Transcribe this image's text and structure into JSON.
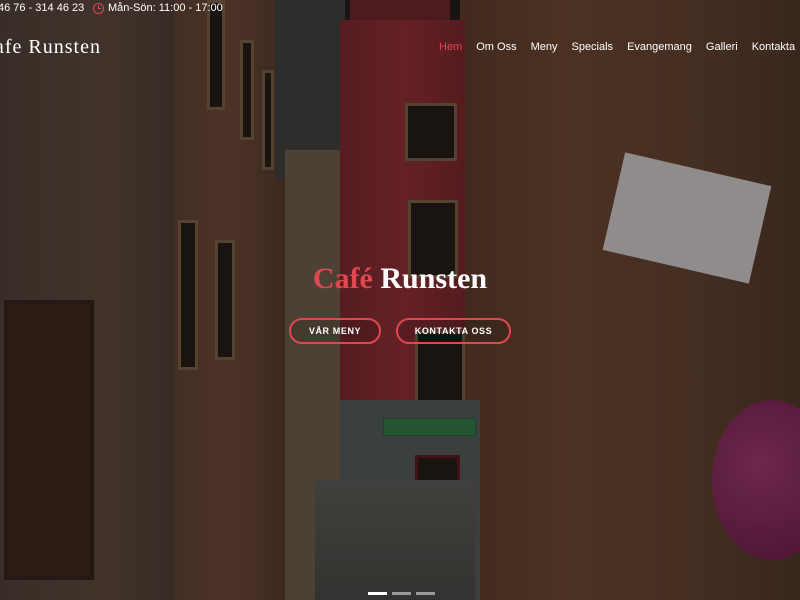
{
  "topbar": {
    "phone": "46 76 - 314 46 23",
    "hours": "Mån-Sön: 11:00 - 17:00"
  },
  "header": {
    "logo": "afe Runsten",
    "nav": [
      "Hem",
      "Om Oss",
      "Meny",
      "Specials",
      "Evangemang",
      "Galleri",
      "Kontakta"
    ],
    "active_nav": "Hem"
  },
  "hero": {
    "title_accent": "Café",
    "title_rest": "Runsten",
    "buttons": {
      "menu": "VÅR MENY",
      "contact": "KONTAKTA OSS"
    },
    "slide_count": 3,
    "active_slide": 1
  },
  "colors": {
    "accent": "#e0474f"
  },
  "icons": {
    "hours": "clock-icon"
  }
}
